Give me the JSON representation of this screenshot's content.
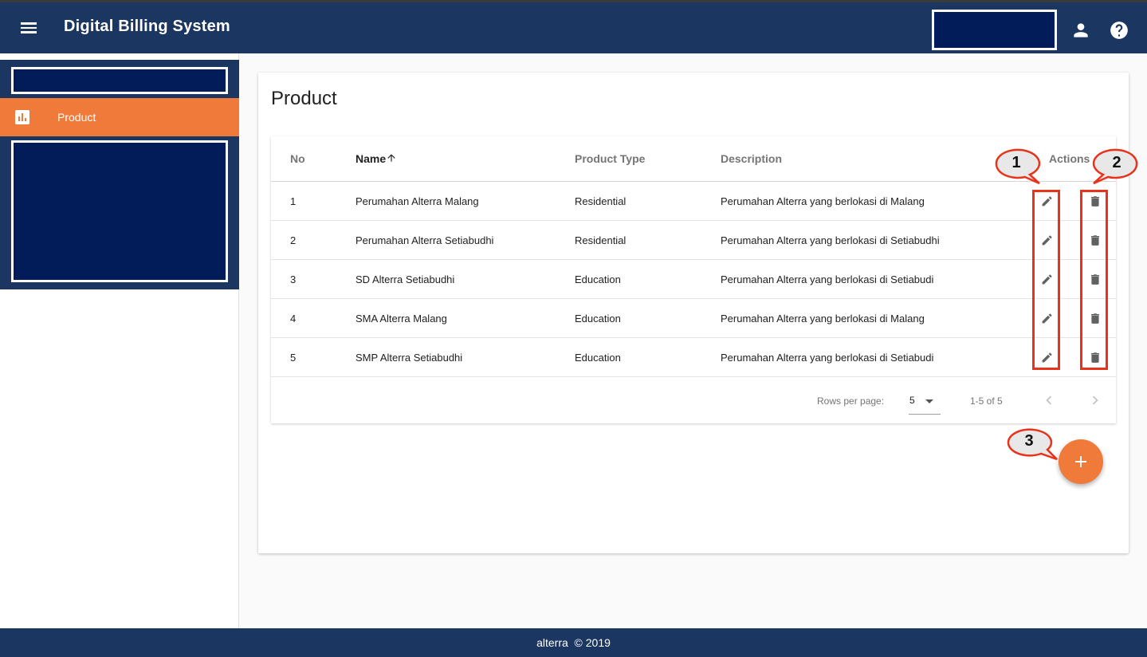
{
  "header": {
    "title": "Digital Billing System"
  },
  "sidebar": {
    "items": [
      {
        "label": "Product"
      }
    ]
  },
  "page": {
    "title": "Product"
  },
  "table": {
    "columns": {
      "no": "No",
      "name": "Name",
      "type": "Product Type",
      "description": "Description",
      "actions": "Actions"
    },
    "rows": [
      {
        "no": "1",
        "name": "Perumahan Alterra Malang",
        "type": "Residential",
        "description": "Perumahan Alterra yang berlokasi di Malang"
      },
      {
        "no": "2",
        "name": "Perumahan Alterra Setiabudhi",
        "type": "Residential",
        "description": "Perumahan Alterra yang berlokasi di Setiabudhi"
      },
      {
        "no": "3",
        "name": "SD Alterra Setiabudhi",
        "type": "Education",
        "description": "Perumahan Alterra yang berlokasi di Setiabudi"
      },
      {
        "no": "4",
        "name": "SMA Alterra Malang",
        "type": "Education",
        "description": "Perumahan Alterra yang berlokasi di Malang"
      },
      {
        "no": "5",
        "name": "SMP Alterra Setiabudhi",
        "type": "Education",
        "description": "Perumahan Alterra yang berlokasi di Setiabudi"
      }
    ],
    "pagination": {
      "rows_per_page_label": "Rows per page:",
      "rows_per_page": "5",
      "range": "1-5 of 5"
    }
  },
  "annotations": {
    "edit": "1",
    "delete": "2",
    "add": "3"
  },
  "footer": {
    "text": "alterra  © 2019"
  },
  "colors": {
    "primary": "#1b3660",
    "accent": "#f07a3a",
    "highlight": "#e8321a"
  },
  "icons": [
    "menu-icon",
    "user-icon",
    "help-icon",
    "chart-icon",
    "arrow-up-icon",
    "edit-icon",
    "delete-icon",
    "chevron-left-icon",
    "chevron-right-icon",
    "plus-icon"
  ]
}
